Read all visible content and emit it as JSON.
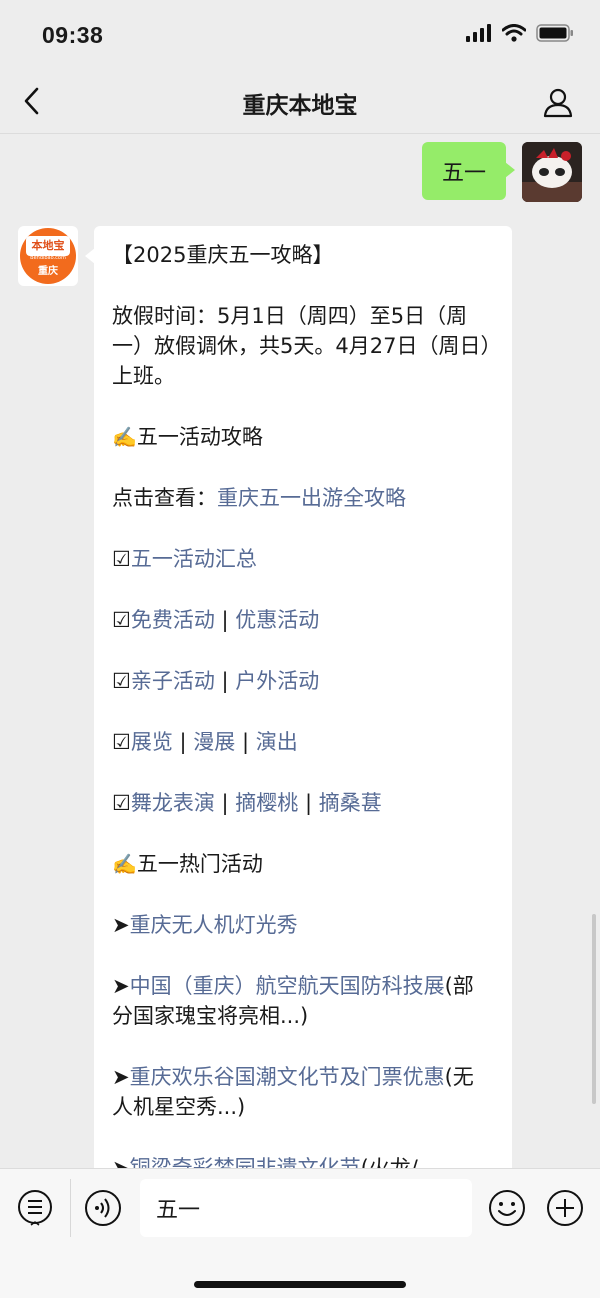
{
  "status_bar": {
    "time": "09:38"
  },
  "header": {
    "title": "重庆本地宝"
  },
  "chat": {
    "sent_message": "五一",
    "bot_avatar": {
      "logo_text": "本地宝",
      "domain_text": "Bendibao.com",
      "city_text": "重庆"
    },
    "reply": {
      "title": "【2025重庆五一攻略】",
      "holiday": "放假时间：5月1日（周四）至5日（周一）放假调休，共5天。4月27日（周日）上班。",
      "section1": "五一活动攻略",
      "view_prefix": "点击查看：",
      "view_link": "重庆五一出游全攻略",
      "check_icon": "☑",
      "sep": " | ",
      "item1": "五一活动汇总",
      "item2a": "免费活动",
      "item2b": "优惠活动",
      "item3a": "亲子活动",
      "item3b": "户外活动",
      "item4a": "展览",
      "item4b": "漫展",
      "item4c": "演出",
      "item5a": "舞龙表演",
      "item5b": "摘樱桃",
      "item5c": "摘桑葚",
      "section2": "五一热门活动",
      "arrow": "➤",
      "hot1": "重庆无人机灯光秀",
      "hot2_link": "中国（重庆）航空航天国防科技展",
      "hot2_note": "(部分国家瑰宝将亮相...)",
      "hot3_link": "重庆欢乐谷国潮文化节及门票优惠",
      "hot3_note": "(无人机星空秀...)",
      "hot4_link": "铜梁奇彩梦园非遗文化节",
      "hot4_note": "(火龙/"
    }
  },
  "input_bar": {
    "value": "五一"
  },
  "colors": {
    "sent_bubble": "#95ec69",
    "link": "#576b95",
    "background": "#ededed"
  }
}
